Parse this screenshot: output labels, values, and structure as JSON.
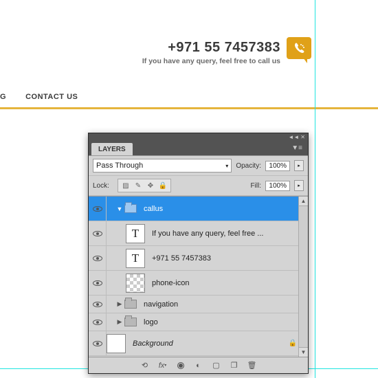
{
  "header": {
    "phone": "+971 55 7457383",
    "tagline": "If you have any query, feel free to call us"
  },
  "nav": {
    "items": [
      "G",
      "CONTACT US"
    ]
  },
  "panel": {
    "tab": "LAYERS",
    "blend_mode": "Pass Through",
    "opacity_label": "Opacity:",
    "opacity_value": "100%",
    "lock_label": "Lock:",
    "fill_label": "Fill:",
    "fill_value": "100%",
    "layers": [
      {
        "name": "callus",
        "type": "folder",
        "selected": true,
        "indent": 1,
        "expanded": true,
        "eye": true
      },
      {
        "name": "If you have any query, feel free ...",
        "type": "text",
        "indent": 2,
        "eye": true
      },
      {
        "name": "+971 55 7457383",
        "type": "text",
        "indent": 2,
        "eye": true
      },
      {
        "name": "phone-icon",
        "type": "raster",
        "indent": 2,
        "eye": true
      },
      {
        "name": "navigation",
        "type": "folder",
        "indent": 1,
        "expanded": false,
        "eye": true,
        "short": true
      },
      {
        "name": "logo",
        "type": "folder",
        "indent": 1,
        "expanded": false,
        "eye": true,
        "short": true
      },
      {
        "name": "Background",
        "type": "bg",
        "indent": 0,
        "eye": true,
        "locked": true,
        "italic": true
      }
    ]
  }
}
